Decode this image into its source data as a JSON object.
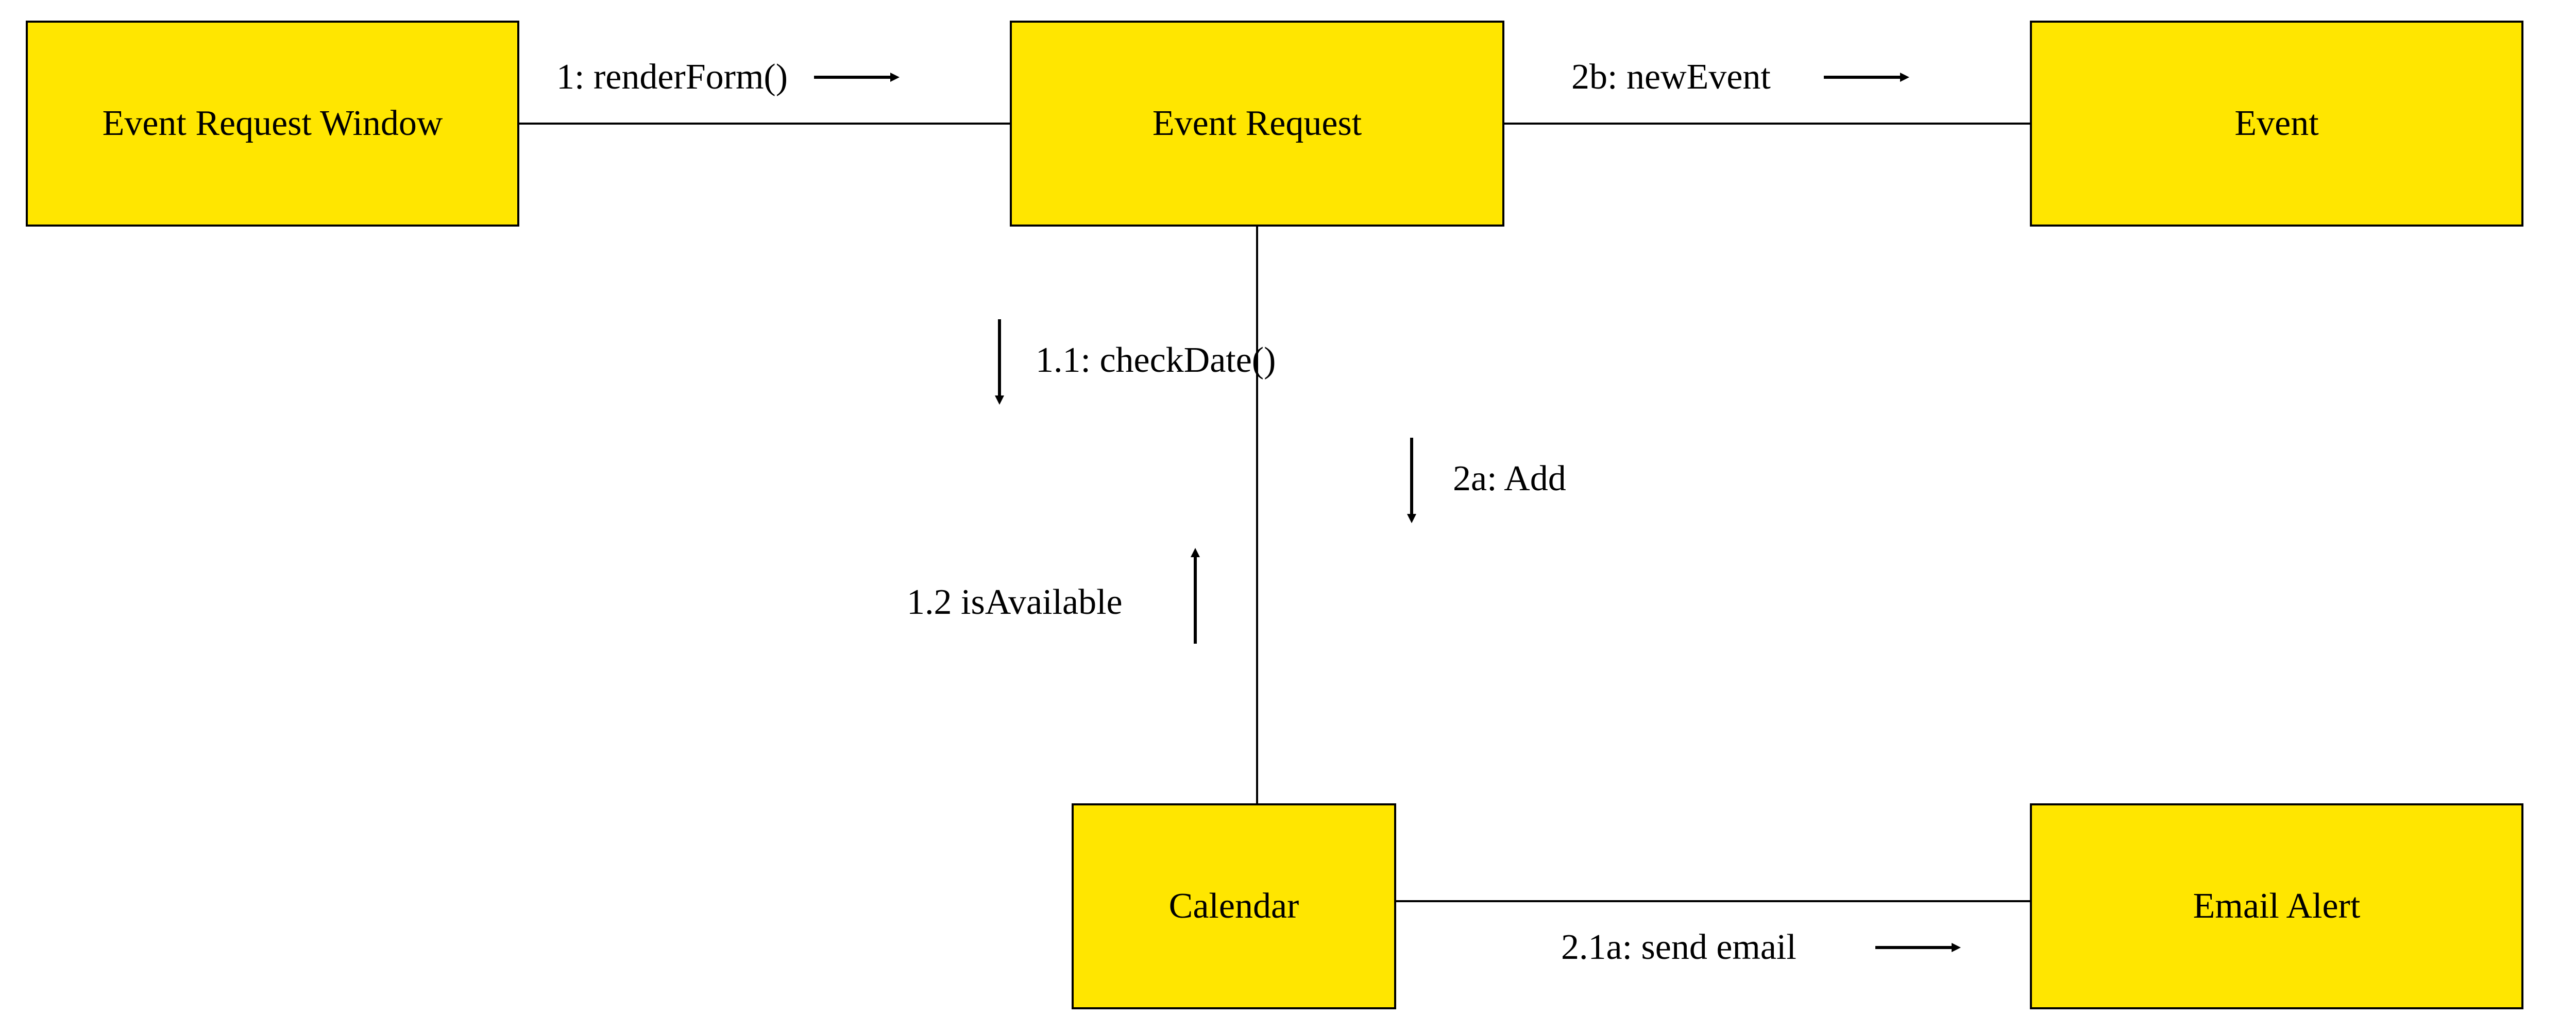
{
  "nodes": {
    "eventRequestWindow": "Event Request Window",
    "eventRequest": "Event Request",
    "event": "Event",
    "calendar": "Calendar",
    "emailAlert": "Email Alert"
  },
  "messages": {
    "renderForm": "1: renderForm()",
    "newEvent": "2b: newEvent",
    "checkDate": "1.1: checkDate()",
    "add": "2a: Add",
    "isAvailable": "1.2 isAvailable",
    "sendEmail": "2.1a: send email"
  }
}
